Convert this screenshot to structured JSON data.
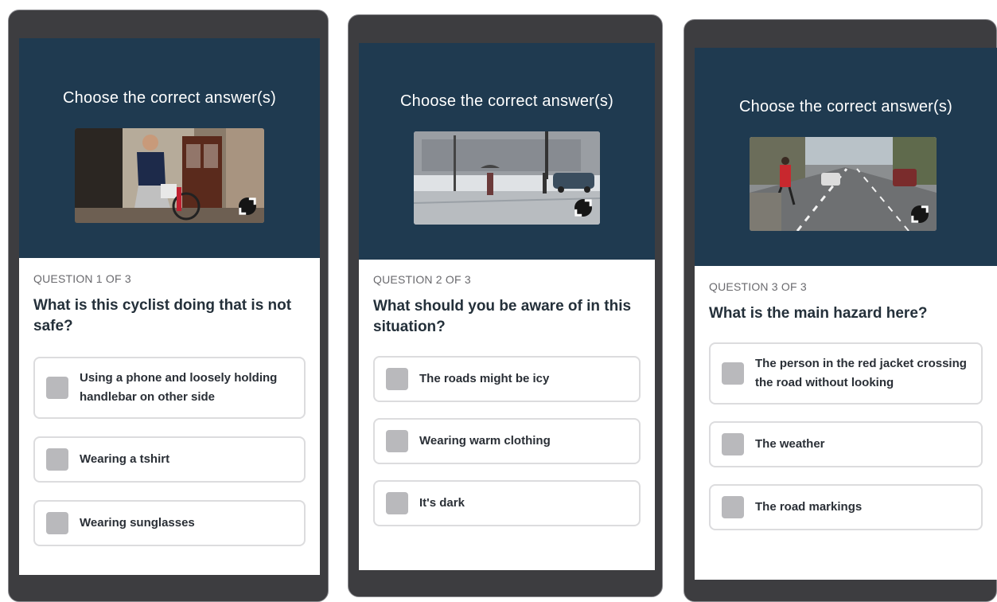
{
  "panels": [
    {
      "heading": "Choose the correct answer(s)",
      "question_number": "QUESTION 1 OF 3",
      "question": "What is this cyclist doing that is not safe?",
      "options": [
        "Using a phone and loosely holding handlebar on other side",
        "Wearing a tshirt",
        "Wearing sunglasses"
      ]
    },
    {
      "heading": "Choose the correct answer(s)",
      "question_number": "QUESTION 2 OF 3",
      "question": "What should you be aware of in this situation?",
      "options": [
        "The roads might be icy",
        "Wearing warm clothing",
        "It's dark"
      ]
    },
    {
      "heading": "Choose the correct answer(s)",
      "question_number": "QUESTION 3 OF 3",
      "question": "What is the main hazard here?",
      "options": [
        "The person in the red jacket crossing the road without looking",
        "The weather",
        "The road markings"
      ]
    }
  ],
  "icons": {
    "expand": "expand-icon",
    "checkbox": "checkbox"
  },
  "colors": {
    "hero_background": "#1f3a50",
    "device_frame": "#3d3d40",
    "checkbox": "#b9b9bc"
  }
}
